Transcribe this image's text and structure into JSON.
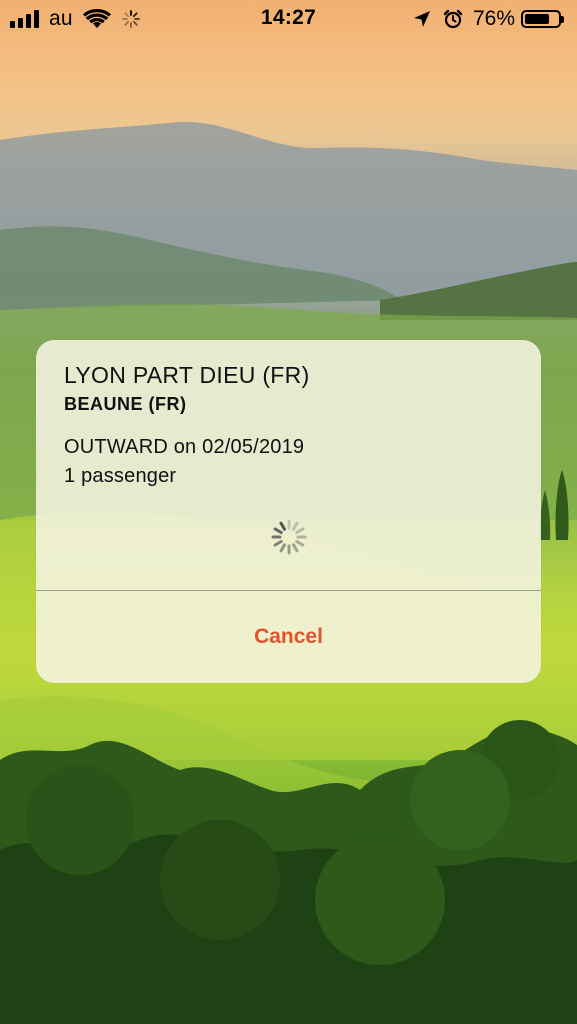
{
  "status_bar": {
    "carrier": "au",
    "time": "14:27",
    "battery_percent": "76%",
    "battery_level": 0.76,
    "icons": [
      "signal-icon",
      "wifi-icon",
      "activity-icon",
      "location-arrow-icon",
      "alarm-icon",
      "battery-icon"
    ]
  },
  "dialog": {
    "origin": "LYON PART DIEU (FR)",
    "destination": "BEAUNE (FR)",
    "outward": "OUTWARD on 02/05/2019",
    "passengers": "1 passenger",
    "cancel_label": "Cancel",
    "cancel_color": "#e2532d",
    "loading_icon": "spinner-icon"
  }
}
